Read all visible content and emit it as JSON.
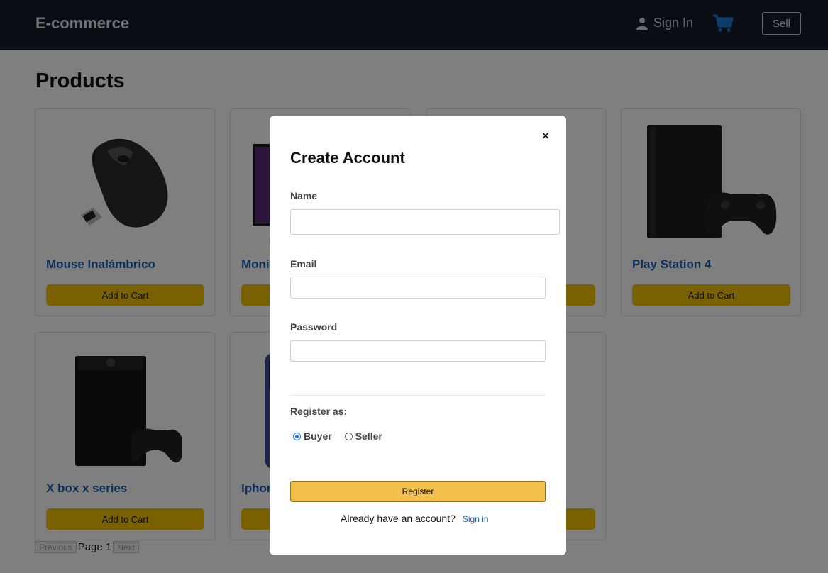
{
  "header": {
    "brand": "E-commerce",
    "sign_in_label": "Sign In",
    "sell_label": "Sell"
  },
  "page": {
    "title": "Products"
  },
  "products": [
    {
      "title": "Mouse Inalámbrico",
      "button": "Add to Cart",
      "image_icon": "wireless-mouse"
    },
    {
      "title": "Moni",
      "button": "Add to Cart",
      "image_icon": "monitor"
    },
    {
      "title": "",
      "button": "Add to Cart",
      "image_icon": "product"
    },
    {
      "title": "Play Station 4",
      "button": "Add to Cart",
      "image_icon": "playstation-console"
    },
    {
      "title": "X box x series",
      "button": "Add to Cart",
      "image_icon": "xbox-console"
    },
    {
      "title": "Iphor",
      "button": "Add to Cart",
      "image_icon": "iphone"
    },
    {
      "title": "",
      "button": "Add to Cart",
      "image_icon": "product"
    }
  ],
  "pagination": {
    "previous": "Previous",
    "page_text": "Page 1",
    "next": "Next"
  },
  "modal": {
    "close_glyph": "×",
    "title": "Create Account",
    "name_label": "Name",
    "name_value": "",
    "email_label": "Email",
    "email_value": "",
    "password_label": "Password",
    "password_value": "",
    "register_as_label": "Register as:",
    "roles": [
      {
        "label": "Buyer",
        "selected": true
      },
      {
        "label": "Seller",
        "selected": false
      }
    ],
    "register_button": "Register",
    "already_text": "Already have an account?",
    "sign_in_link": "Sign in"
  },
  "colors": {
    "navbar": "#131a28",
    "accent_blue": "#1560b8",
    "cart_blue": "#1a78d6",
    "add_to_cart": "#f2c000",
    "register": "#f2c04b"
  }
}
